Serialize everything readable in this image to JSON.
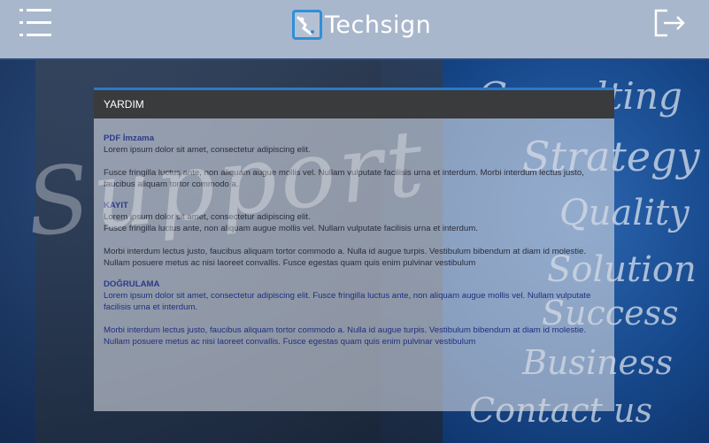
{
  "header": {
    "brand_name": "Techsign",
    "menu_icon": "hamburger-menu-icon",
    "logout_icon": "logout-icon"
  },
  "background": {
    "words": [
      "Consulting",
      "Strategy",
      "Quality",
      "Solution",
      "Success",
      "Business",
      "Contact us"
    ],
    "big_word": "Support"
  },
  "panel": {
    "title": "YARDIM",
    "sections": [
      {
        "heading": "PDF İmzama",
        "paragraphs": [
          "Lorem ipsum dolor sit amet, consectetur adipiscing elit.",
          " Fusce fringilla luctus ante, non aliquam augue mollis vel. Nullam vulputate facilisis urna et interdum. Morbi interdum lectus justo, faucibus aliquam tortor commodo a."
        ]
      },
      {
        "heading": "KAYIT",
        "paragraphs": [
          "Lorem ipsum dolor sit amet, consectetur adipiscing elit.",
          " Fusce fringilla luctus ante, non aliquam augue mollis vel. Nullam vulputate facilisis urna et interdum.",
          "Morbi interdum lectus justo, faucibus aliquam tortor commodo a. Nulla id augue turpis. Vestibulum bibendum at diam id molestie. Nullam posuere metus ac nisi laoreet convallis. Fusce egestas quam quis enim pulvinar vestibulum"
        ]
      },
      {
        "heading": "DOĞRULAMA",
        "paragraphs": [
          "Lorem ipsum dolor sit amet, consectetur adipiscing elit. Fusce fringilla luctus ante, non aliquam augue mollis vel. Nullam vulputate facilisis urna et interdum.",
          "Morbi interdum lectus justo, faucibus aliquam tortor commodo a. Nulla id augue turpis. Vestibulum bibendum at diam id molestie. Nullam posuere metus ac nisi laoreet convallis. Fusce egestas quam quis enim pulvinar vestibulum"
        ]
      }
    ]
  },
  "colors": {
    "accent": "#2a79c9",
    "header_bar": "#3a3b3d",
    "heading_text": "#2b3a8a"
  }
}
